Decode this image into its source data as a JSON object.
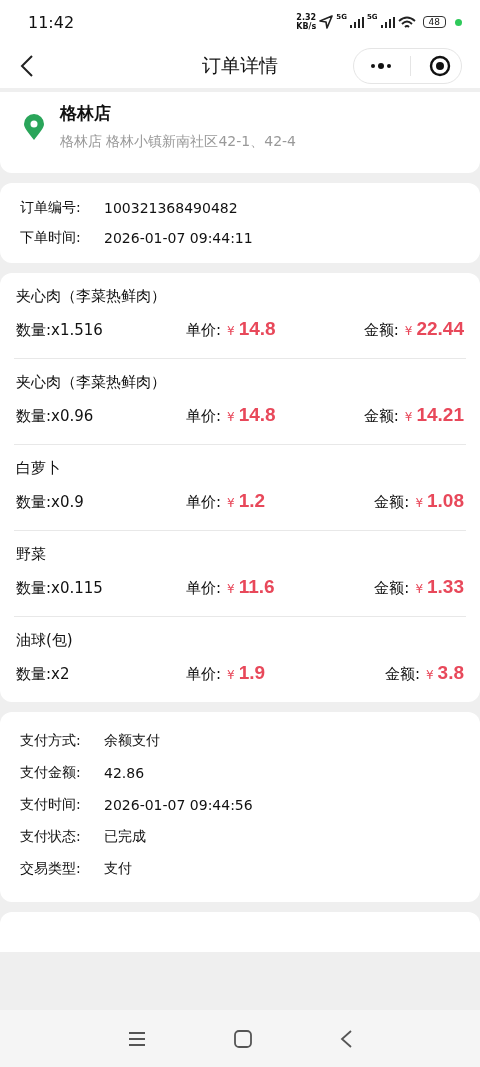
{
  "status_bar": {
    "time": "11:42",
    "speed_value": "2.32",
    "speed_unit": "KB/s",
    "signals": [
      "5G",
      "5G"
    ],
    "battery": "48"
  },
  "nav": {
    "title": "订单详情"
  },
  "store": {
    "name": "格林店",
    "address": "格林店 格林小镇新南社区42-1、42-4"
  },
  "order": [
    {
      "label": "订单编号:",
      "value": "100321368490482"
    },
    {
      "label": "下单时间:",
      "value": "2026-01-07 09:44:11"
    }
  ],
  "items": [
    {
      "name": "夹心肉（李菜热鲜肉）",
      "qty_label": "数量:",
      "qty": "x1.516",
      "price_label": "单价:",
      "price_currency": "¥",
      "price": "14.8",
      "amount_label": "金额:",
      "amount_currency": "¥",
      "amount": "22.44"
    },
    {
      "name": "夹心肉（李菜热鲜肉）",
      "qty_label": "数量:",
      "qty": "x0.96",
      "price_label": "单价:",
      "price_currency": "¥",
      "price": "14.8",
      "amount_label": "金额:",
      "amount_currency": "¥",
      "amount": "14.21"
    },
    {
      "name": "白萝卜",
      "qty_label": "数量:",
      "qty": "x0.9",
      "price_label": "单价:",
      "price_currency": "¥",
      "price": "1.2",
      "amount_label": "金额:",
      "amount_currency": "¥",
      "amount": "1.08"
    },
    {
      "name": "野菜",
      "qty_label": "数量:",
      "qty": "x0.115",
      "price_label": "单价:",
      "price_currency": "¥",
      "price": "11.6",
      "amount_label": "金额:",
      "amount_currency": "¥",
      "amount": "1.33"
    },
    {
      "name": "油球(包)",
      "qty_label": "数量:",
      "qty": "x2",
      "price_label": "单价:",
      "price_currency": "¥",
      "price": "1.9",
      "amount_label": "金额:",
      "amount_currency": "¥",
      "amount": "3.8"
    }
  ],
  "payment": [
    {
      "label": "支付方式:",
      "value": "余额支付"
    },
    {
      "label": "支付金额:",
      "value": "42.86"
    },
    {
      "label": "支付时间:",
      "value": "2026-01-07 09:44:56"
    },
    {
      "label": "支付状态:",
      "value": "已完成"
    },
    {
      "label": "交易类型:",
      "value": "支付"
    }
  ]
}
